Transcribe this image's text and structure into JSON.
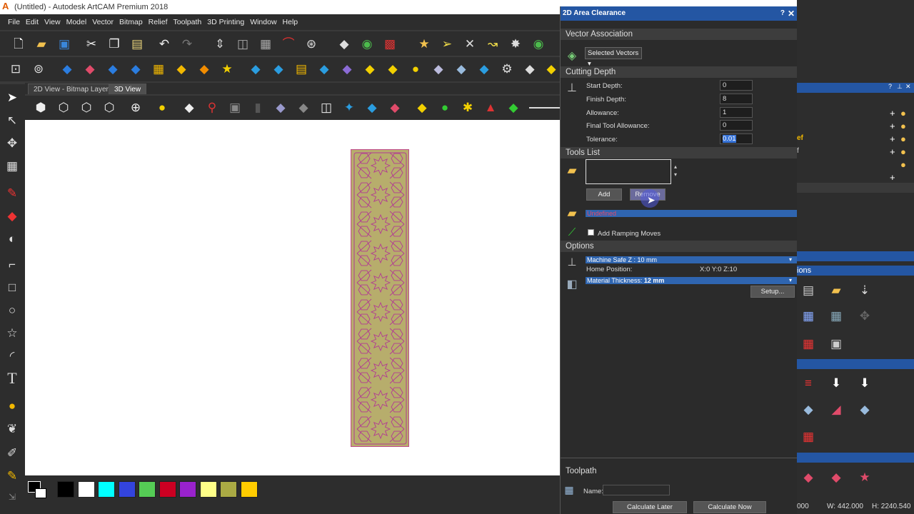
{
  "window": {
    "title": "(Untitled) - Autodesk ArtCAM Premium 2018",
    "app_icon": "A",
    "minimize": "─",
    "maximize": "❐",
    "close": "✕"
  },
  "menu": [
    "File",
    "Edit",
    "View",
    "Model",
    "Vector",
    "Bitmap",
    "Relief",
    "Toolpath",
    "3D Printing",
    "Window",
    "Help"
  ],
  "tabs": [
    "2D View - Bitmap Layer",
    "3D View"
  ],
  "palette": [
    "#000000",
    "#ffffff",
    "#00ffff",
    "#3344dd",
    "#55cc55",
    "#cc0022",
    "#9922cc",
    "#ffff88",
    "#aaaa44",
    "#ffcc00"
  ],
  "dialog": {
    "title": "2D Area Clearance",
    "help": "?",
    "close": "✕",
    "vector_association": {
      "heading": "Vector Association",
      "selection": "Selected Vectors ▾"
    },
    "cutting_depth": {
      "heading": "Cutting Depth",
      "start_label": "Start Depth:",
      "start_value": "0",
      "finish_label": "Finish Depth:",
      "finish_value": "8",
      "allowance_label": "Allowance:",
      "allowance_value": "1",
      "final_label": "Final Tool Allowance:",
      "final_value": "0",
      "tolerance_label": "Tolerance:",
      "tolerance_value": "0.01"
    },
    "tools_list": {
      "heading": "Tools List",
      "add": "Add",
      "remove": "Remove",
      "undefined_tool": "Undefined",
      "ramping_label": "Add Ramping Moves"
    },
    "options": {
      "heading": "Options",
      "safe_z": "Machine Safe Z : 10 mm",
      "home_label": "Home Position:",
      "home_value": "X:0 Y:0 Z:10",
      "material_label": "Material Thickness:",
      "material_value": "12 mm",
      "setup": "Setup..."
    },
    "toolpath": {
      "heading": "Toolpath",
      "name_label": "Name:",
      "name_value": "",
      "calc_later": "Calculate Later",
      "calc_now": "Calculate Now"
    }
  },
  "right_pane": {
    "help": "?",
    "pin": "⊥",
    "close": "✕",
    "partial_text_1": "ef",
    "partial_text_2": "f",
    "section_title": "ions"
  },
  "status": {
    "coord_partial": "000",
    "width": "W: 442.000",
    "height": "H: 2240.540"
  }
}
